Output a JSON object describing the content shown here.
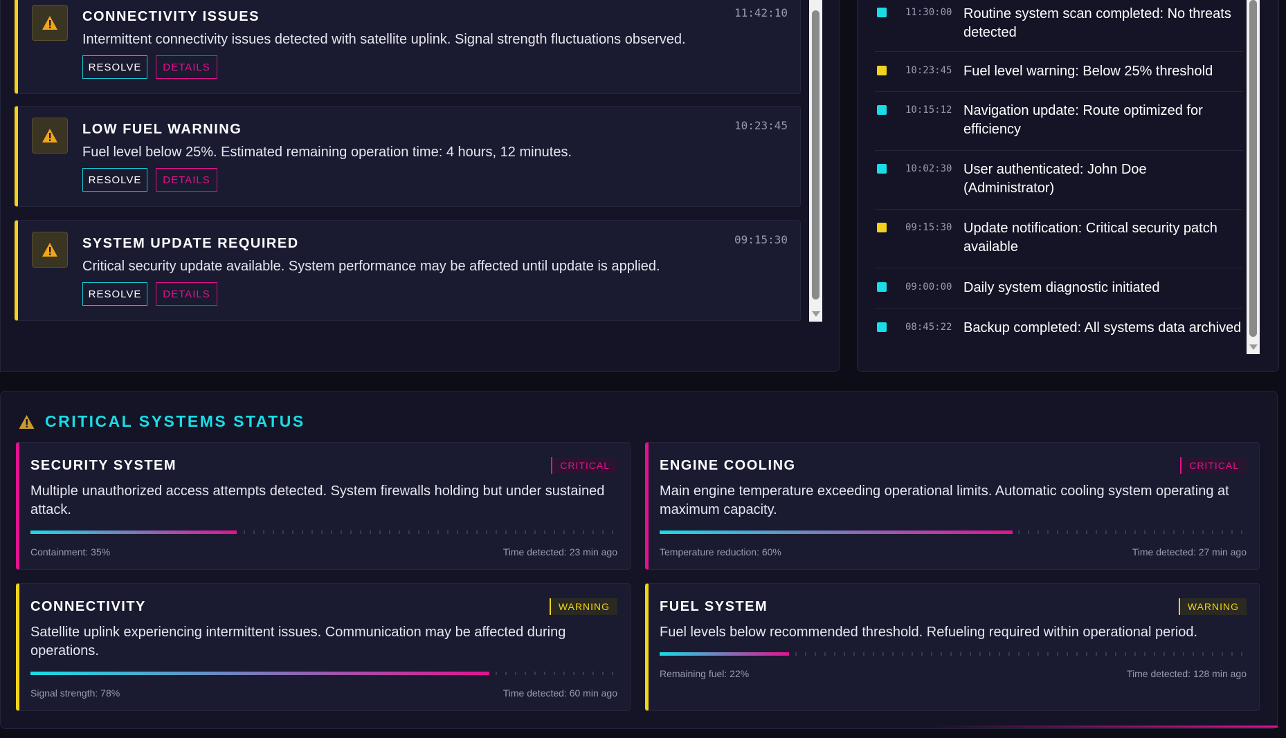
{
  "alerts": [
    {
      "title": "CONNECTIVITY ISSUES",
      "time": "11:42:10",
      "message": "Intermittent connectivity issues detected with satellite uplink. Signal strength fluctuations observed.",
      "resolve_label": "RESOLVE",
      "details_label": "DETAILS"
    },
    {
      "title": "LOW FUEL WARNING",
      "time": "10:23:45",
      "message": "Fuel level below 25%. Estimated remaining operation time: 4 hours, 12 minutes.",
      "resolve_label": "RESOLVE",
      "details_label": "DETAILS"
    },
    {
      "title": "SYSTEM UPDATE REQUIRED",
      "time": "09:15:30",
      "message": "Critical security update available. System performance may be affected until update is applied.",
      "resolve_label": "RESOLVE",
      "details_label": "DETAILS"
    }
  ],
  "log": [
    {
      "time": "11:30:00",
      "text": "Routine system scan completed: No threats detected",
      "color": "#18dde6"
    },
    {
      "time": "10:23:45",
      "text": "Fuel level warning: Below 25% threshold",
      "color": "#f2d21b"
    },
    {
      "time": "10:15:12",
      "text": "Navigation update: Route optimized for efficiency",
      "color": "#18dde6"
    },
    {
      "time": "10:02:30",
      "text": "User authenticated: John Doe (Administrator)",
      "color": "#18dde6"
    },
    {
      "time": "09:15:30",
      "text": "Update notification: Critical security patch available",
      "color": "#f2d21b"
    },
    {
      "time": "09:00:00",
      "text": "Daily system diagnostic initiated",
      "color": "#18dde6"
    },
    {
      "time": "08:45:22",
      "text": "Backup completed: All systems data archived",
      "color": "#18dde6"
    }
  ],
  "critical": {
    "title": "CRITICAL SYSTEMS STATUS",
    "systems": [
      {
        "name": "SECURITY SYSTEM",
        "badge": "CRITICAL",
        "level": "critical",
        "description": "Multiple unauthorized access attempts detected. System firewalls holding but under sustained attack.",
        "metric": "Containment: 35%",
        "progress": 0.35,
        "detected": "Time detected: 23 min ago"
      },
      {
        "name": "ENGINE COOLING",
        "badge": "CRITICAL",
        "level": "critical",
        "description": "Main engine temperature exceeding operational limits. Automatic cooling system operating at maximum capacity.",
        "metric": "Temperature reduction: 60%",
        "progress": 0.6,
        "detected": "Time detected: 27 min ago"
      },
      {
        "name": "CONNECTIVITY",
        "badge": "WARNING",
        "level": "warning",
        "description": "Satellite uplink experiencing intermittent issues. Communication may be affected during operations.",
        "metric": "Signal strength: 78%",
        "progress": 0.78,
        "detected": "Time detected: 60 min ago"
      },
      {
        "name": "FUEL SYSTEM",
        "badge": "WARNING",
        "level": "warning",
        "description": "Fuel levels below recommended threshold. Refueling required within operational period.",
        "metric": "Remaining fuel: 22%",
        "progress": 0.22,
        "detected": "Time detected: 128 min ago"
      }
    ]
  },
  "colors": {
    "accent_cyan": "#18dde6",
    "accent_magenta": "#e3128f",
    "warning_yellow": "#f2d21b"
  },
  "icons": {
    "alert": "warning-triangle-icon",
    "critical_header": "warning-triangle-icon"
  }
}
